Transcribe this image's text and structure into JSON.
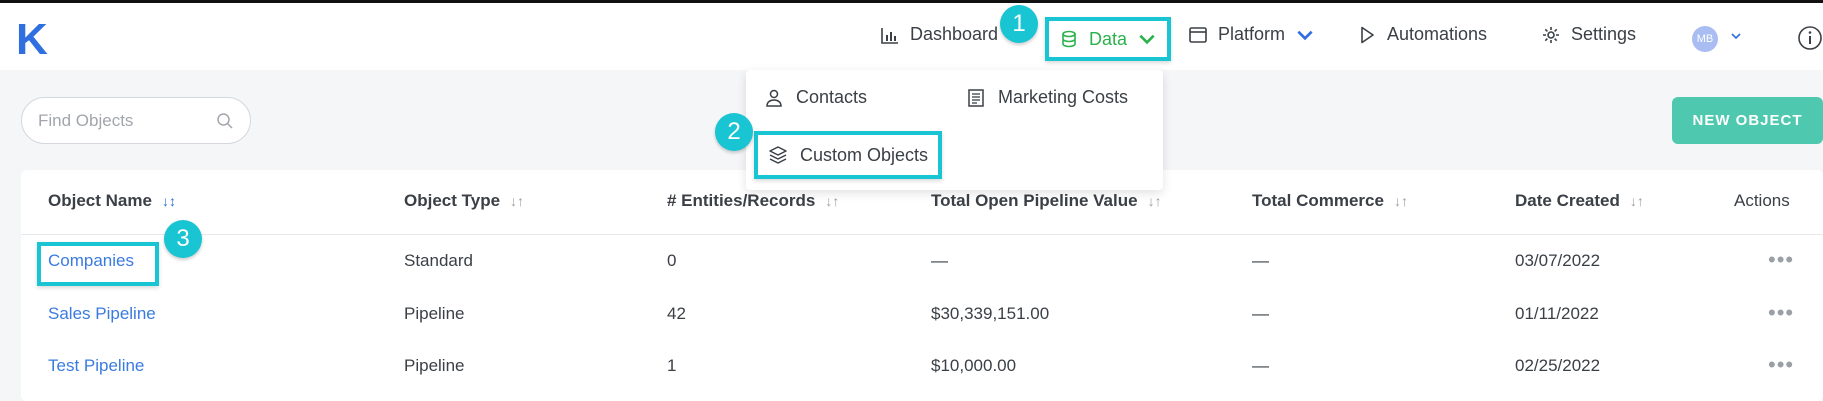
{
  "app": {
    "logo_letter": "K"
  },
  "nav": {
    "dashboard": "Dashboard",
    "data": "Data",
    "platform": "Platform",
    "automations": "Automations",
    "settings": "Settings",
    "avatar_initials": "MB"
  },
  "callouts": [
    "1",
    "2",
    "3"
  ],
  "data_menu": {
    "contacts": "Contacts",
    "marketing_costs": "Marketing Costs",
    "custom_objects": "Custom Objects"
  },
  "search": {
    "placeholder": "Find Objects"
  },
  "new_object_button": "NEW OBJECT",
  "table": {
    "columns": [
      "Object Name",
      "Object Type",
      "# Entities/Records",
      "Total Open Pipeline Value",
      "Total Commerce",
      "Date Created",
      "Actions"
    ],
    "rows": [
      {
        "name": "Companies",
        "type": "Standard",
        "records": "0",
        "pipeline_value": "—",
        "commerce": "—",
        "date": "03/07/2022",
        "actions": "•••"
      },
      {
        "name": "Sales Pipeline",
        "type": "Pipeline",
        "records": "42",
        "pipeline_value": "$30,339,151.00",
        "commerce": "—",
        "date": "01/11/2022",
        "actions": "•••"
      },
      {
        "name": "Test Pipeline",
        "type": "Pipeline",
        "records": "1",
        "pipeline_value": "$10,000.00",
        "commerce": "—",
        "date": "02/25/2022",
        "actions": "•••"
      }
    ]
  },
  "colors": {
    "accent": "#2f6fe0",
    "highlight": "#19c4d3",
    "data_active": "#2bb24c",
    "button": "#4ec9b0"
  },
  "icons": [
    "bar-chart-icon",
    "database-icon",
    "window-icon",
    "play-icon",
    "gear-icon",
    "info-icon",
    "user-icon",
    "document-icon",
    "layers-icon",
    "search-icon",
    "chevron-down-icon",
    "sort-icon"
  ]
}
